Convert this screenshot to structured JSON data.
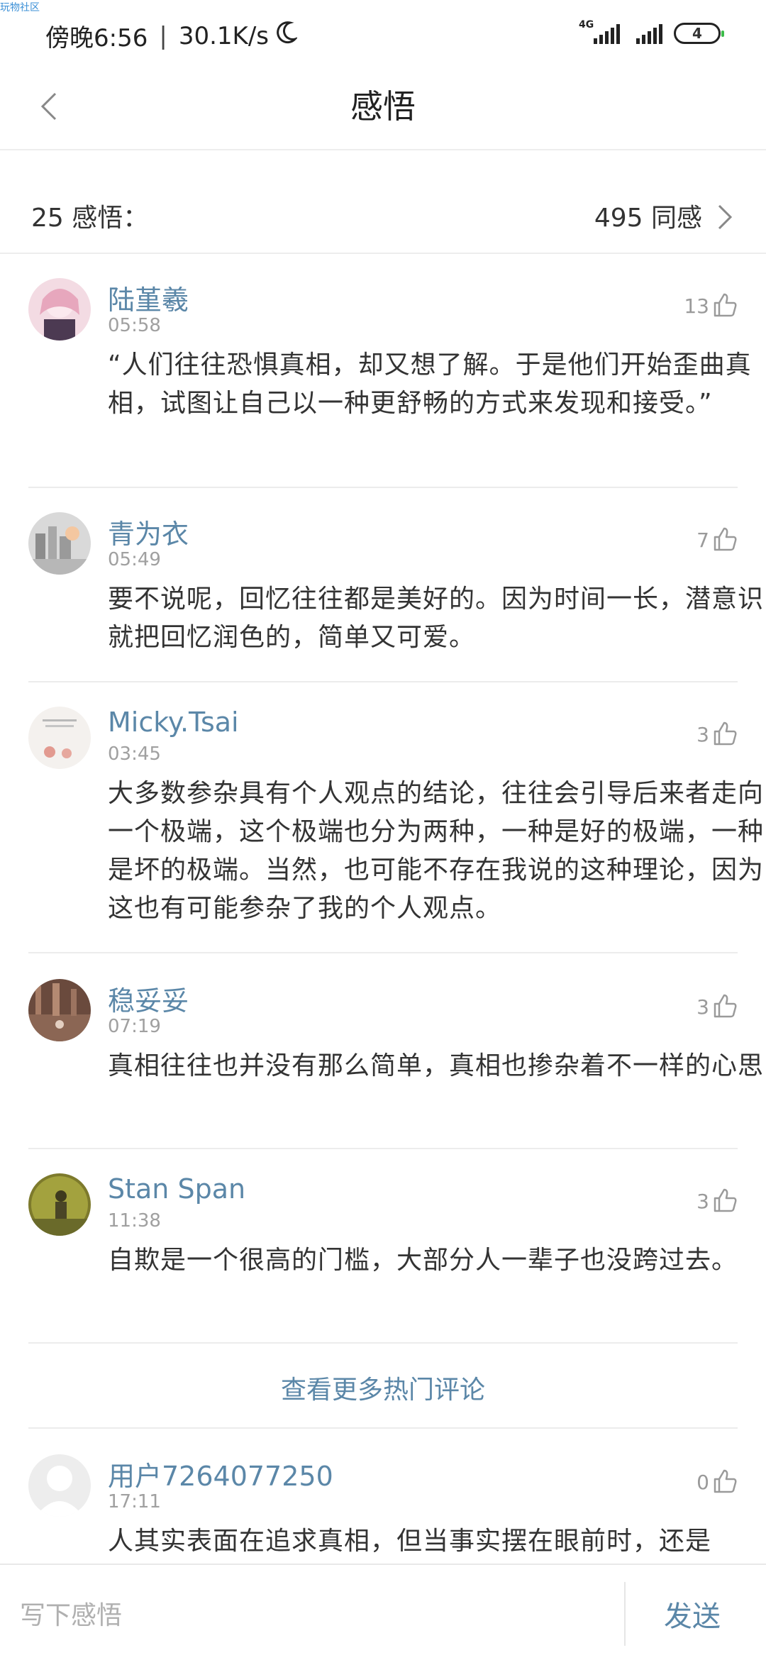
{
  "corner_tag": "玩物社区",
  "status_bar": {
    "time": "傍晚6:56",
    "speed": "30.1K/s",
    "network_label": "4G",
    "battery": "4"
  },
  "nav": {
    "title": "感悟"
  },
  "summary": {
    "count_label": "25 感悟：",
    "agree_label": "495 同感"
  },
  "comments": [
    {
      "name": "陆堇羲",
      "time": "05:58",
      "likes": "13",
      "text": "“人们往往恐惧真相，却又想了解。于是他们开始歪曲真相，试图让自己以一种更舒畅的方式来发现和接受。”"
    },
    {
      "name": "青为衣",
      "time": "05:49",
      "likes": "7",
      "text": "要不说呢，回忆往往都是美好的。因为时间一长，潜意识就把回忆润色的，简单又可爱。"
    },
    {
      "name": "Micky.Tsai",
      "time": "03:45",
      "likes": "3",
      "text": "大多数参杂具有个人观点的结论，往往会引导后来者走向一个极端，这个极端也分为两种，一种是好的极端，一种是坏的极端。当然，也可能不存在我说的这种理论，因为这也有可能参杂了我的个人观点。"
    },
    {
      "name": "稳妥妥",
      "time": "07:19",
      "likes": "3",
      "text": "真相往往也并没有那么简单，真相也掺杂着不一样的心思"
    },
    {
      "name": "Stan Span",
      "time": "11:38",
      "likes": "3",
      "text": "自欺是一个很高的门槛，大部分人一辈子也没跨过去。"
    }
  ],
  "more_label": "查看更多热门评论",
  "latest_comment": {
    "name": "用户7264077250",
    "time": "17:11",
    "likes": "0",
    "text": "人其实表面在追求真相，但当事实摆在眼前时，还是"
  },
  "bottom_bar": {
    "input_placeholder": "写下感悟",
    "send_label": "发送"
  },
  "colors": {
    "accent": "#5b87a8",
    "text": "#333333",
    "meta": "#a0a0a0",
    "divider": "#ececec"
  }
}
